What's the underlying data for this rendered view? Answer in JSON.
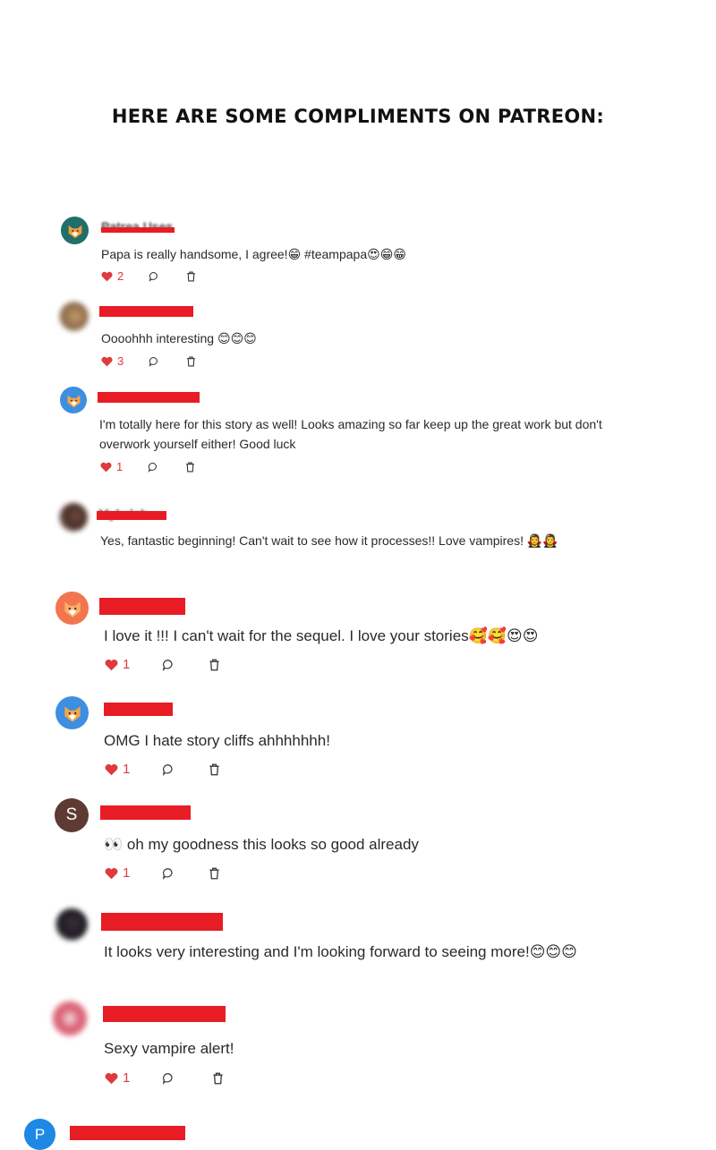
{
  "header": {
    "title": "HERE ARE SOME COMPLIMENTS ON PATREON:"
  },
  "colors": {
    "like": "#e03a3e",
    "redaction": "#e81c25"
  },
  "comments": [
    {
      "avatar_icon": "fox-icon",
      "avatar_letter": "",
      "text": "Papa is really handsome, I agree!😁 #teampapa😍😁😁",
      "likes": "2"
    },
    {
      "avatar_icon": "photo-avatar",
      "avatar_letter": "",
      "text": "Oooohhh interesting 😊😊😊",
      "likes": "3"
    },
    {
      "avatar_icon": "fox-icon",
      "avatar_letter": "",
      "text": "I'm totally here for this story as well! Looks amazing so far keep up the great work but don't overwork yourself either! Good luck",
      "likes": "1"
    },
    {
      "avatar_icon": "photo-avatar",
      "avatar_letter": "",
      "text": "Yes, fantastic beginning! Can't wait to see how it processes!! Love vampires! 🧛‍♀️🧛‍♀️",
      "likes": ""
    },
    {
      "avatar_icon": "fox-icon",
      "avatar_letter": "",
      "text": "I love it !!! I can't wait for the sequel. I love your stories🥰🥰😍😍",
      "likes": "1"
    },
    {
      "avatar_icon": "fox-icon",
      "avatar_letter": "",
      "text": "OMG I hate story cliffs ahhhhhhh!",
      "likes": "1"
    },
    {
      "avatar_icon": "letter-avatar",
      "avatar_letter": "S",
      "text": "👀 oh my goodness this looks so good already",
      "likes": "1"
    },
    {
      "avatar_icon": "photo-avatar",
      "avatar_letter": "",
      "text": "It looks very interesting and I'm looking forward to seeing more!😊😊😊",
      "likes": ""
    },
    {
      "avatar_icon": "photo-avatar",
      "avatar_letter": "",
      "text": "Sexy vampire alert!",
      "likes": "1"
    },
    {
      "avatar_icon": "letter-avatar",
      "avatar_letter": "P",
      "text": "",
      "likes": ""
    }
  ]
}
